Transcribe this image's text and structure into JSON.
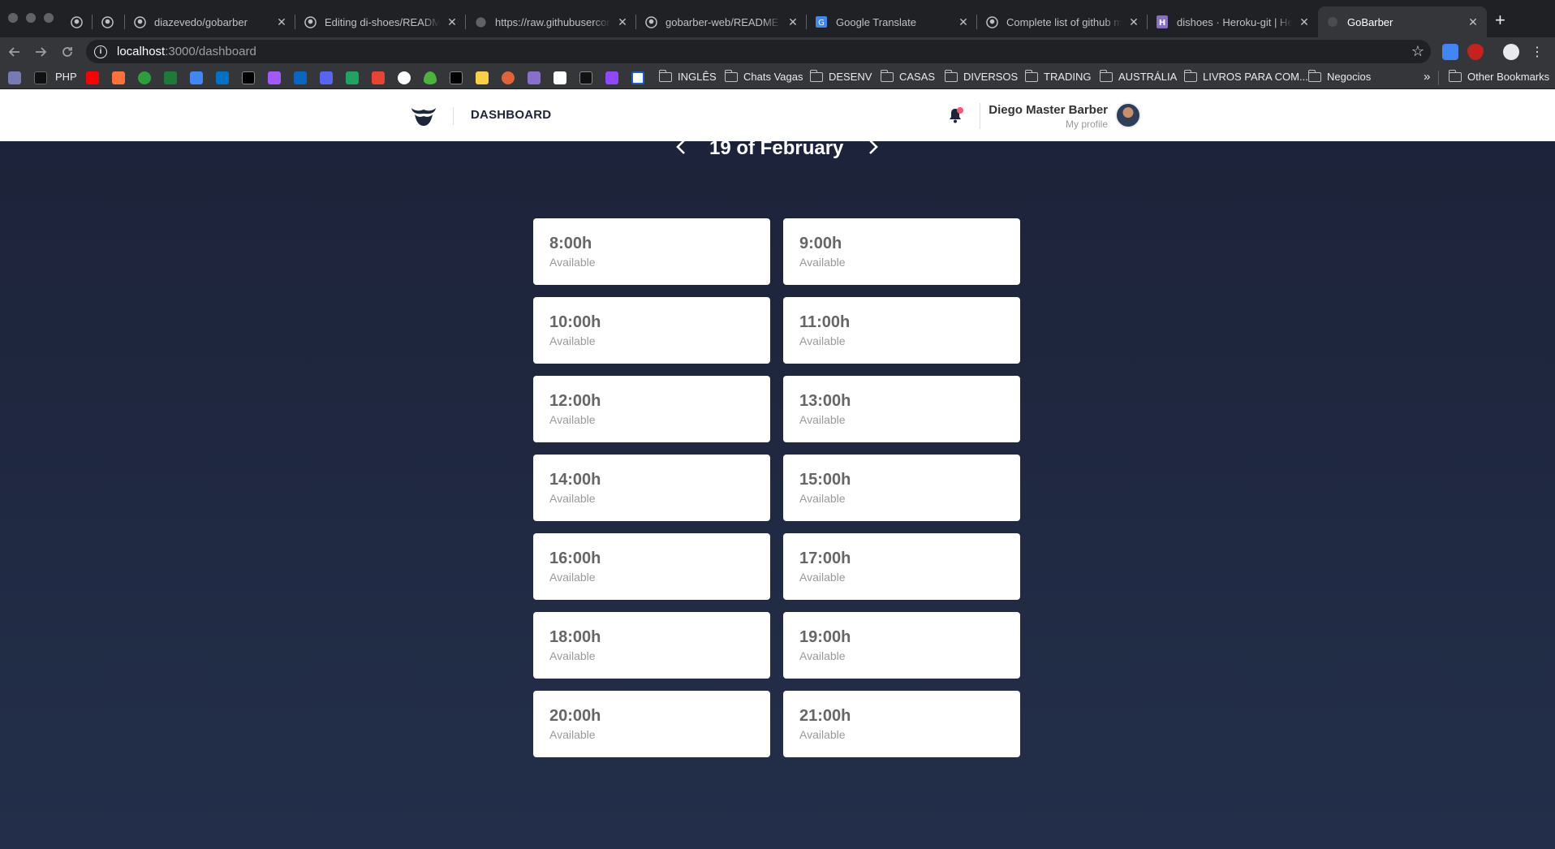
{
  "browser": {
    "tabs": [
      {
        "title": "",
        "favicon": "github-icon"
      },
      {
        "title": "",
        "favicon": "github-icon"
      },
      {
        "title": "diazevedo/gobarber",
        "favicon": "github-icon"
      },
      {
        "title": "Editing di-shoes/README.md",
        "favicon": "github-icon"
      },
      {
        "title": "https://raw.githubusercontent.com",
        "favicon": "globe-icon"
      },
      {
        "title": "gobarber-web/README.md",
        "favicon": "github-icon"
      },
      {
        "title": "Google Translate",
        "favicon": "translate-icon"
      },
      {
        "title": "Complete list of github markdown",
        "favicon": "github-icon"
      },
      {
        "title": "dishoes · Heroku-git | Heroku",
        "favicon": "heroku-icon"
      },
      {
        "title": "GoBarber",
        "favicon": "gobarber-icon",
        "active": true
      }
    ],
    "address": {
      "host": "localhost",
      "path": ":3000/dashboard"
    },
    "bookmarks": {
      "php_label": "PHP",
      "folders": [
        "INGLÊS",
        "Chats Vagas",
        "DESENV",
        "CASAS",
        "DIVERSOS",
        "TRADING",
        "AUSTRÁLIA",
        "LIVROS PARA COM...",
        "Negocios"
      ],
      "other": "Other Bookmarks",
      "overflow": "»"
    }
  },
  "app": {
    "header": {
      "nav_label": "DASHBOARD",
      "profile_name": "Diego Master Barber",
      "profile_link": "My profile"
    },
    "date_title": "19 of February",
    "slots": [
      {
        "time": "8:00h",
        "status": "Available"
      },
      {
        "time": "9:00h",
        "status": "Available"
      },
      {
        "time": "10:00h",
        "status": "Available"
      },
      {
        "time": "11:00h",
        "status": "Available"
      },
      {
        "time": "12:00h",
        "status": "Available"
      },
      {
        "time": "13:00h",
        "status": "Available"
      },
      {
        "time": "14:00h",
        "status": "Available"
      },
      {
        "time": "15:00h",
        "status": "Available"
      },
      {
        "time": "16:00h",
        "status": "Available"
      },
      {
        "time": "17:00h",
        "status": "Available"
      },
      {
        "time": "18:00h",
        "status": "Available"
      },
      {
        "time": "19:00h",
        "status": "Available"
      },
      {
        "time": "20:00h",
        "status": "Available"
      },
      {
        "time": "21:00h",
        "status": "Available"
      }
    ]
  },
  "colors": {
    "background_top": "#1c2238",
    "background_bottom": "#232f4a",
    "header_bg": "#ffffff",
    "notification_dot": "#ff5577"
  }
}
